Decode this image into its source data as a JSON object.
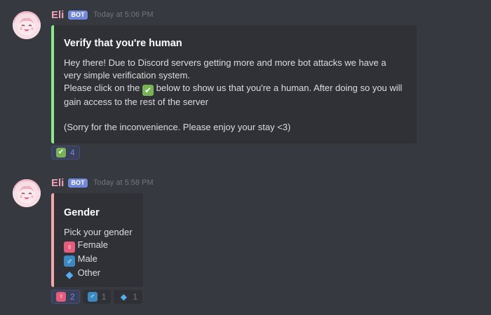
{
  "messages": [
    {
      "username": "Eli",
      "bot_tag": "BOT",
      "timestamp": "Today at 5:06 PM",
      "embed": {
        "accent_color": "#8ce88c",
        "title": "Verify that you're human",
        "line1": "Hey there! Due to Discord servers getting more and more bot attacks we have a",
        "line2": "very simple verification system.",
        "line3_before": "Please click on the",
        "line3_emoji": "✔",
        "line3_after": "below to show us that you're a human. After doing so you will",
        "line4": "gain access to the rest of the server",
        "line5": "(Sorry for the inconvenience. Please enjoy your stay <3)"
      },
      "reactions": [
        {
          "emoji": "✔",
          "icon": "check-mark-icon",
          "count": "4",
          "me": true
        }
      ]
    },
    {
      "username": "Eli",
      "bot_tag": "BOT",
      "timestamp": "Today at 5:58 PM",
      "embed": {
        "accent_color": "#f3a7ad",
        "title": "Gender",
        "intro": "Pick your gender",
        "options": [
          {
            "emoji": "♀",
            "icon": "female-sign-icon",
            "label": "Female"
          },
          {
            "emoji": "♂",
            "icon": "male-sign-icon",
            "label": "Male"
          },
          {
            "emoji": "◆",
            "icon": "diamond-icon",
            "label": "Other"
          }
        ]
      },
      "reactions": [
        {
          "emoji": "♀",
          "icon": "female-sign-icon",
          "count": "2",
          "me": true
        },
        {
          "emoji": "♂",
          "icon": "male-sign-icon",
          "count": "1",
          "me": false
        },
        {
          "emoji": "◆",
          "icon": "diamond-icon",
          "count": "1",
          "me": false
        }
      ]
    }
  ],
  "colors": {
    "background": "#36393f",
    "embed_background": "#2f3136",
    "username": "#f2a1b4",
    "bot_tag": "#7289da",
    "timestamp": "#72767d"
  }
}
